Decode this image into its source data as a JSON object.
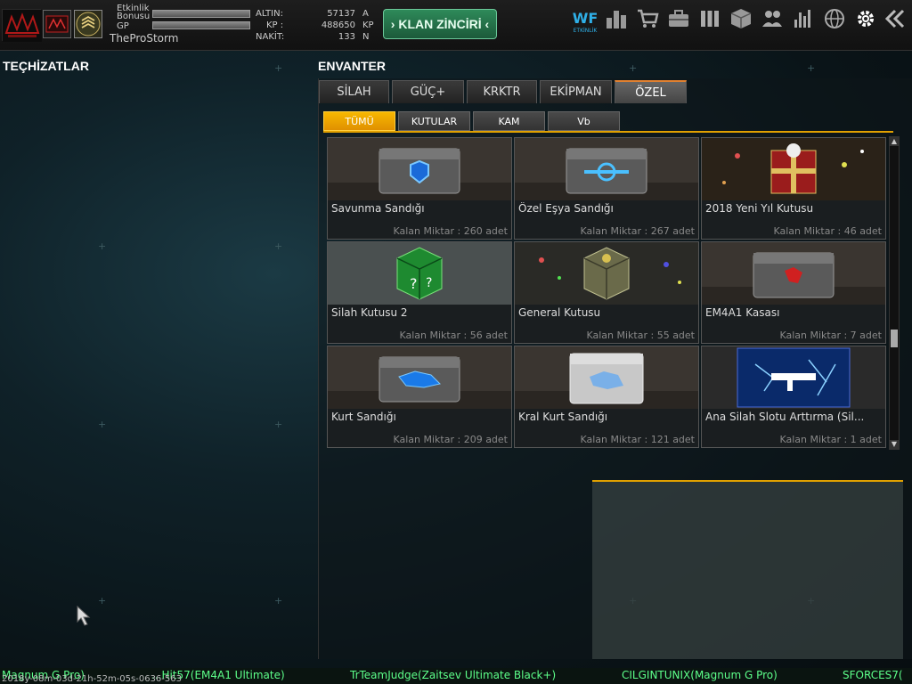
{
  "topbar": {
    "etkinlik_label": "Etkinlik",
    "bonus_label": "Bonusu",
    "gp_label": "GP",
    "username": "TheProStorm",
    "money": [
      {
        "key": "ALTIN:",
        "value": "57137",
        "unit": "A"
      },
      {
        "key": "KP :",
        "value": "488650",
        "unit": "KP"
      },
      {
        "key": "NAKİT:",
        "value": "133",
        "unit": "N"
      }
    ],
    "klan_button": "› KLAN ZİNCİRİ ‹",
    "icons": [
      "etkinlik-icon",
      "ranking-icon",
      "shop-cart-icon",
      "briefcase-icon",
      "clan-icon",
      "inventory-box-icon",
      "friends-icon",
      "stats-icon",
      "globe-icon",
      "settings-gear-icon",
      "back-arrow-icon"
    ],
    "etkinlik_icon_label": "ETKİNLİK"
  },
  "left_panel": {
    "title": "TEÇHİZATLAR"
  },
  "inventory": {
    "title": "ENVANTER",
    "tabs": [
      "SİLAH",
      "GÜÇ+",
      "KRKTR",
      "EKİPMAN",
      "ÖZEL"
    ],
    "active_tab": "ÖZEL",
    "subtabs": [
      "TÜMÜ",
      "KUTULAR",
      "KAM",
      "Vb"
    ],
    "active_subtab": "TÜMÜ",
    "items": [
      {
        "name": "Savunma Sandığı",
        "qty": "Kalan Miktar : 260 adet"
      },
      {
        "name": "Özel Eşya Sandığı",
        "qty": "Kalan Miktar : 267 adet"
      },
      {
        "name": "2018 Yeni Yıl Kutusu",
        "qty": "Kalan Miktar : 46 adet"
      },
      {
        "name": "Silah Kutusu 2",
        "qty": "Kalan Miktar : 56 adet"
      },
      {
        "name": "General Kutusu",
        "qty": "Kalan Miktar : 55 adet"
      },
      {
        "name": "EM4A1 Kasası",
        "qty": "Kalan Miktar : 7 adet"
      },
      {
        "name": "Kurt Sandığı",
        "qty": "Kalan Miktar : 209 adet"
      },
      {
        "name": "Kral Kurt Sandığı",
        "qty": "Kalan Miktar : 121 adet"
      },
      {
        "name": "Ana Silah Slotu Arttırma (Sil...",
        "qty": "Kalan Miktar : 1 adet"
      }
    ]
  },
  "ticker": {
    "entries": [
      "Magnum G Pro)",
      "...Hit57(EM4A1 Ultimate)",
      "TrTeamJudge(Zaitsev Ultimate Black+)",
      "CILGINTUNIX(Magnum G Pro)",
      "SFORCES7("
    ],
    "timestamp": "2018y-08m-03d-21h-52m-05s-0636-563"
  },
  "colors": {
    "accent_orange": "#e0a000",
    "klan_green": "#2e8a5a",
    "ticker_green": "#5dff8a"
  }
}
